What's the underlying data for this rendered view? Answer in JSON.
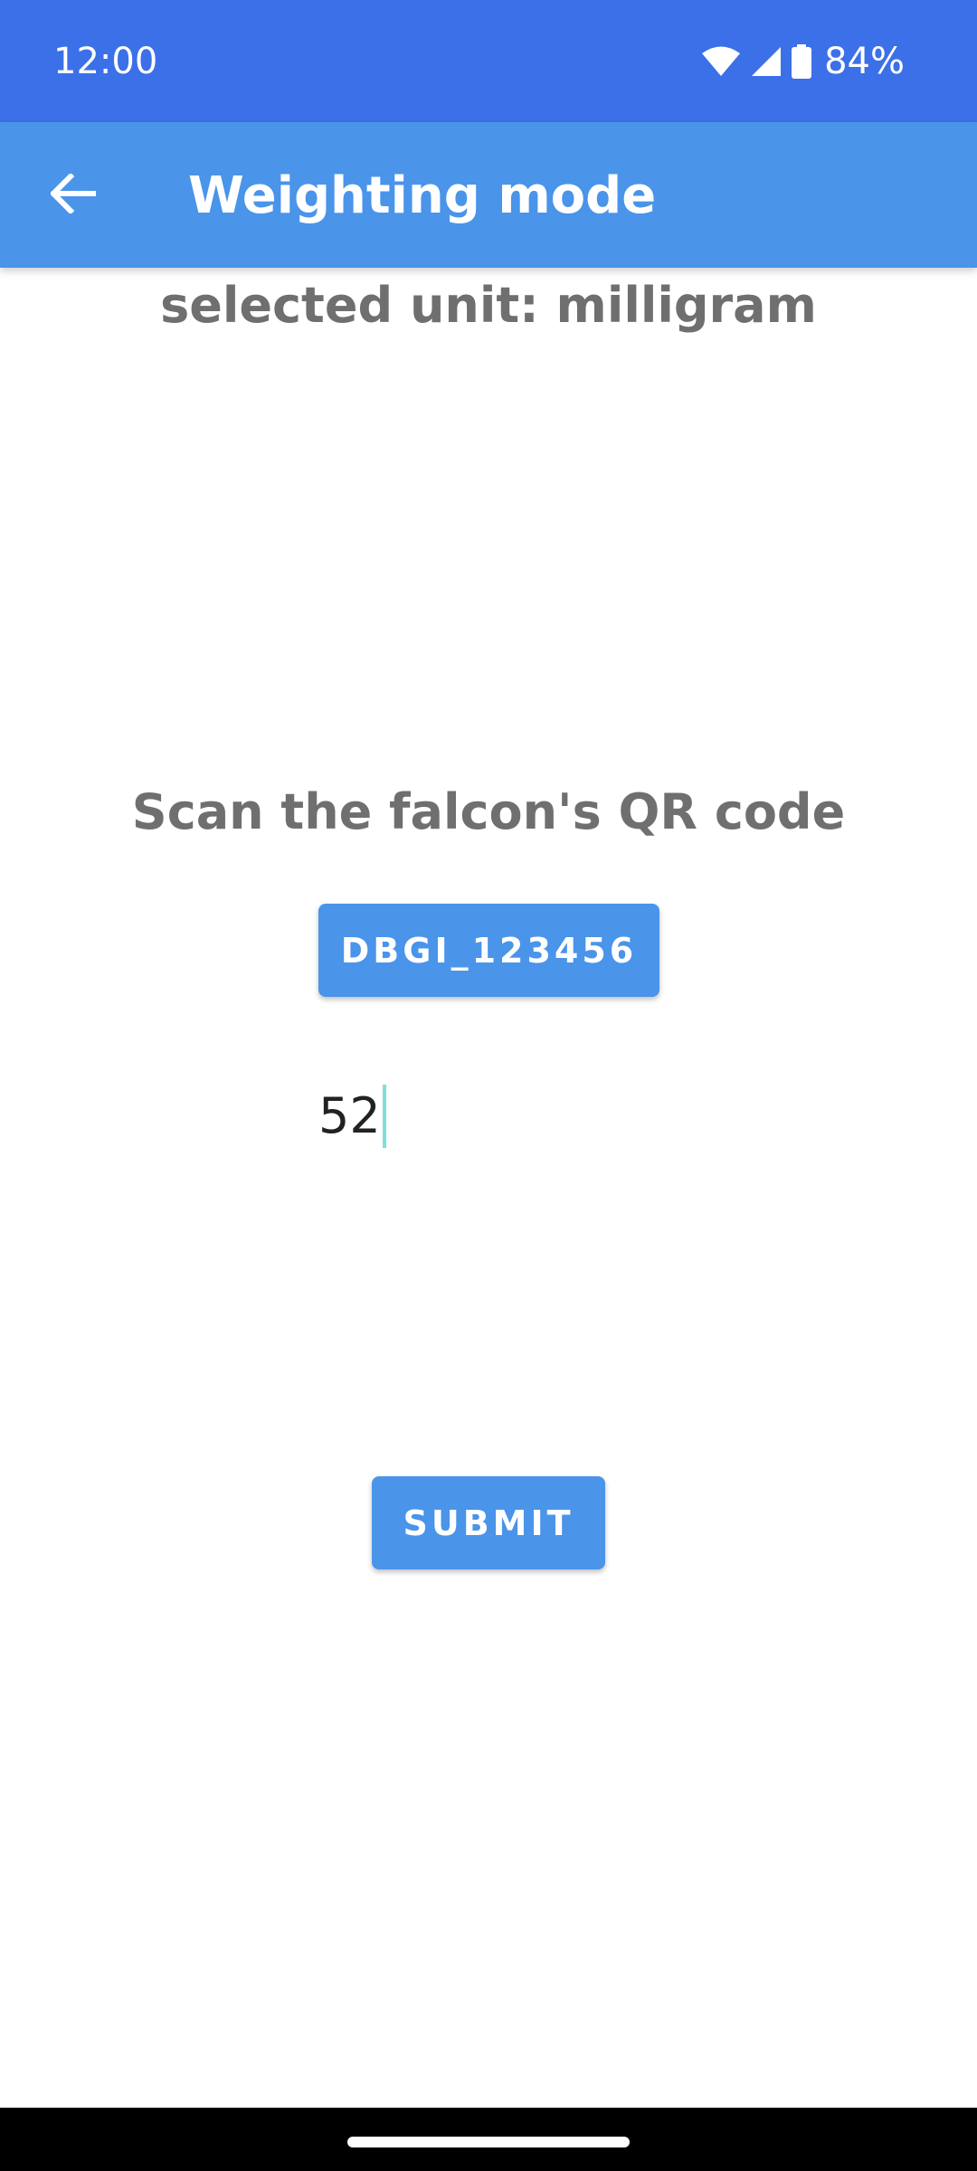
{
  "status_bar": {
    "time": "12:00",
    "battery_percent": "84%",
    "icons": [
      "wifi-icon",
      "cellular-signal-icon",
      "battery-icon"
    ]
  },
  "app_bar": {
    "title": "Weighting mode",
    "back_icon": "arrow-left-icon"
  },
  "content": {
    "unit_label": "selected unit: milligram",
    "scan_label": "Scan the falcon's QR code",
    "qr_button_label": "DBGI_123456",
    "weight_input_value": "52",
    "submit_label": "SUBMIT"
  },
  "colors": {
    "status_bar": "#3b70e8",
    "app_bar": "#4a94ea",
    "button": "#4a94ea",
    "label_text": "#6f6f6f",
    "caret": "#7ee0db"
  }
}
